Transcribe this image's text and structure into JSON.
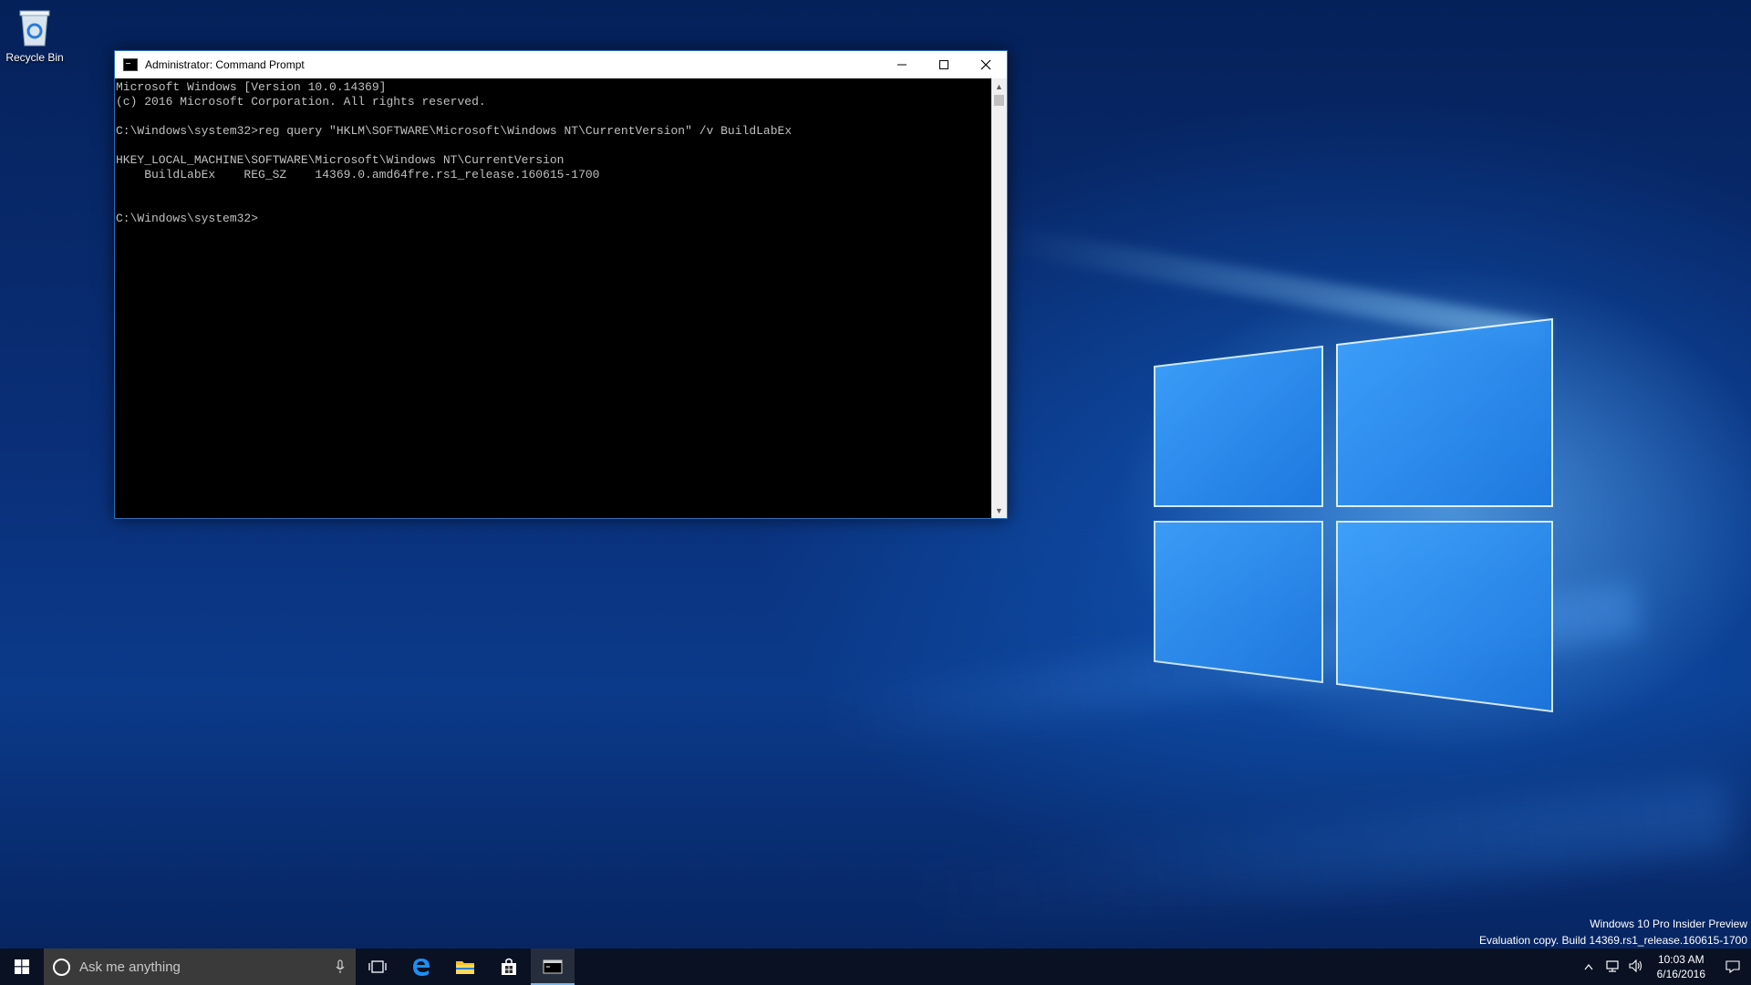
{
  "desktop": {
    "recycle_bin_label": "Recycle Bin"
  },
  "cmd_window": {
    "title": "Administrator: Command Prompt",
    "lines": [
      "Microsoft Windows [Version 10.0.14369]",
      "(c) 2016 Microsoft Corporation. All rights reserved.",
      "",
      "C:\\Windows\\system32>reg query \"HKLM\\SOFTWARE\\Microsoft\\Windows NT\\CurrentVersion\" /v BuildLabEx",
      "",
      "HKEY_LOCAL_MACHINE\\SOFTWARE\\Microsoft\\Windows NT\\CurrentVersion",
      "    BuildLabEx    REG_SZ    14369.0.amd64fre.rs1_release.160615-1700",
      "",
      "",
      "C:\\Windows\\system32>"
    ]
  },
  "watermark": {
    "line1": "Windows 10 Pro Insider Preview",
    "line2": "Evaluation copy. Build 14369.rs1_release.160615-1700"
  },
  "taskbar": {
    "search_placeholder": "Ask me anything",
    "icons": [
      "windows-start-icon",
      "task-view-icon",
      "edge-icon",
      "file-explorer-icon",
      "store-icon",
      "command-prompt-icon"
    ],
    "clock_time": "10:03 AM",
    "clock_date": "6/16/2016"
  },
  "colors": {
    "console_text": "#c0c0c0",
    "console_bg": "#000000",
    "taskbar_accent": "#7ab6ea"
  }
}
